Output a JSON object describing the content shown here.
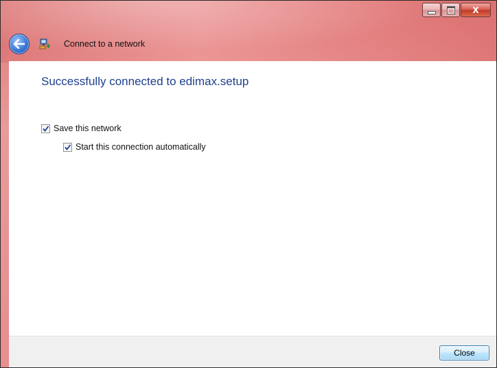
{
  "window": {
    "title": "Connect to a network",
    "controls": {
      "minimize_icon": "minimize-icon",
      "maximize_icon": "maximize-icon",
      "close_glyph": "X"
    }
  },
  "main": {
    "headline": "Successfully connected to edimax.setup",
    "options": [
      {
        "label": "Save this network",
        "checked": true
      },
      {
        "label": "Start this connection automatically",
        "checked": true
      }
    ]
  },
  "footer": {
    "close_label": "Close"
  },
  "colors": {
    "headline": "#1e3f8c",
    "aero_frame": "#e88e8e",
    "footer_bg": "#f0f0f0"
  }
}
